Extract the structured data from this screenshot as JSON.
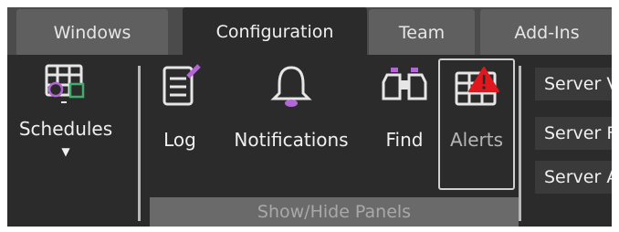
{
  "tabs": [
    {
      "label": "Windows",
      "active": false
    },
    {
      "label": "Configuration",
      "active": true
    },
    {
      "label": "Team",
      "active": false
    },
    {
      "label": "Add-Ins",
      "active": false
    }
  ],
  "ribbon": {
    "schedules_label": "Schedules",
    "buttons": [
      {
        "label": "Log",
        "icon": "log-icon"
      },
      {
        "label": "Notifications",
        "icon": "bell-icon"
      },
      {
        "label": "Find",
        "icon": "binoculars-icon"
      },
      {
        "label": "Alerts",
        "icon": "alerts-grid-icon"
      }
    ],
    "group_label": "Show/Hide Panels",
    "side_items": [
      {
        "label": "Server V"
      },
      {
        "label": "Server F"
      },
      {
        "label": "Server A"
      }
    ]
  },
  "colors": {
    "tab_bar": "#4b4b4b",
    "tab": "#5f5f5f",
    "ribbon": "#2b2b2b",
    "bell_accent": "#b466d6",
    "pencil_accent": "#b466d6",
    "alert_red": "#e0181e",
    "alerts_border": "#cfcfcf"
  }
}
